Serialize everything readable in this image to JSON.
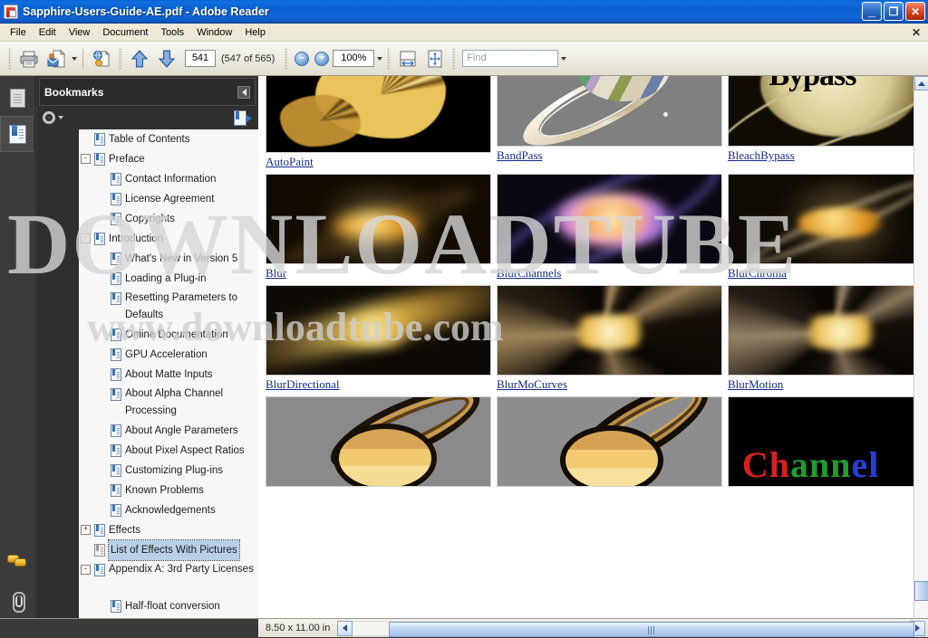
{
  "window": {
    "title": "Sapphire-Users-Guide-AE.pdf - Adobe Reader",
    "app_icon": "pdf-document-icon",
    "minimize_label": "_",
    "restore_label": "❐",
    "close_label": "✕"
  },
  "menubar": {
    "items": [
      {
        "label": "File"
      },
      {
        "label": "Edit"
      },
      {
        "label": "View"
      },
      {
        "label": "Document"
      },
      {
        "label": "Tools"
      },
      {
        "label": "Window"
      },
      {
        "label": "Help"
      }
    ],
    "close_document_label": "✕"
  },
  "toolbar": {
    "print_title": "Print",
    "email_title": "Email",
    "snapshot_title": "Snapshot",
    "previous_page_title": "Previous Page",
    "next_page_title": "Next Page",
    "page_number": "541",
    "page_count_text": "(547 of 565)",
    "zoom_out_label": "–",
    "zoom_in_label": "+",
    "zoom_level": "100%",
    "fit_width_title": "Fit Width",
    "fit_page_title": "Fit Page",
    "find_placeholder": "Find",
    "find_value": ""
  },
  "rail": {
    "items": [
      {
        "name": "pages-panel",
        "icon": "pages-icon",
        "active": false
      },
      {
        "name": "bookmarks-panel",
        "icon": "bookmarks-icon",
        "active": true
      },
      {
        "name": "comments-panel",
        "icon": "comments-icon",
        "active": false
      },
      {
        "name": "attachments-panel",
        "icon": "paperclip-icon",
        "active": false
      }
    ]
  },
  "bookmarks": {
    "panel_title": "Bookmarks",
    "options_label": "Options",
    "collapse_title": "Hide Navigation Pane",
    "expand_current_title": "Expand Current Bookmark",
    "items": [
      {
        "label": "Table of Contents",
        "depth": 1,
        "twisty": "",
        "selected": false,
        "lines": 1,
        "gray": false
      },
      {
        "label": "Preface",
        "depth": 1,
        "twisty": "-",
        "selected": false,
        "lines": 1,
        "gray": false
      },
      {
        "label": "Contact Information",
        "depth": 2,
        "twisty": "",
        "selected": false,
        "lines": 1,
        "gray": false
      },
      {
        "label": "License Agreement",
        "depth": 2,
        "twisty": "",
        "selected": false,
        "lines": 1,
        "gray": false
      },
      {
        "label": "Copyrights",
        "depth": 2,
        "twisty": "",
        "selected": false,
        "lines": 1,
        "gray": false
      },
      {
        "label": "Introduction",
        "depth": 1,
        "twisty": "-",
        "selected": false,
        "lines": 1,
        "gray": false
      },
      {
        "label": "What's New in Version 5",
        "depth": 2,
        "twisty": "",
        "selected": false,
        "lines": 1,
        "gray": false
      },
      {
        "label": "Loading a Plug-in",
        "depth": 2,
        "twisty": "",
        "selected": false,
        "lines": 1,
        "gray": false
      },
      {
        "label": "Resetting Parameters to Defaults",
        "depth": 2,
        "twisty": "",
        "selected": false,
        "lines": 2,
        "gray": false
      },
      {
        "label": "Online Documentation",
        "depth": 2,
        "twisty": "",
        "selected": false,
        "lines": 1,
        "gray": false
      },
      {
        "label": "GPU Acceleration",
        "depth": 2,
        "twisty": "",
        "selected": false,
        "lines": 1,
        "gray": false
      },
      {
        "label": "About Matte Inputs",
        "depth": 2,
        "twisty": "",
        "selected": false,
        "lines": 1,
        "gray": false
      },
      {
        "label": "About Alpha Channel Processing",
        "depth": 2,
        "twisty": "",
        "selected": false,
        "lines": 2,
        "gray": false
      },
      {
        "label": "About Angle Parameters",
        "depth": 2,
        "twisty": "",
        "selected": false,
        "lines": 1,
        "gray": false
      },
      {
        "label": "About Pixel Aspect Ratios",
        "depth": 2,
        "twisty": "",
        "selected": false,
        "lines": 1,
        "gray": false
      },
      {
        "label": "Customizing Plug-ins",
        "depth": 2,
        "twisty": "",
        "selected": false,
        "lines": 1,
        "gray": false
      },
      {
        "label": "Known Problems",
        "depth": 2,
        "twisty": "",
        "selected": false,
        "lines": 1,
        "gray": false
      },
      {
        "label": "Acknowledgements",
        "depth": 2,
        "twisty": "",
        "selected": false,
        "lines": 1,
        "gray": false
      },
      {
        "label": "Effects",
        "depth": 1,
        "twisty": "+",
        "selected": false,
        "lines": 1,
        "gray": false
      },
      {
        "label": "List of Effects With Pictures",
        "depth": 1,
        "twisty": "",
        "selected": true,
        "lines": 1,
        "gray": true
      },
      {
        "label": "Appendix A: 3rd Party Licenses",
        "depth": 1,
        "twisty": "-",
        "selected": false,
        "lines": 2,
        "gray": false
      },
      {
        "label": "Half-float conversion",
        "depth": 2,
        "twisty": "",
        "selected": false,
        "lines": 1,
        "gray": false
      }
    ]
  },
  "document": {
    "watermark_primary": "DOWNLOADTUBE",
    "watermark_secondary": "www.downloadtube.com",
    "effects_grid": [
      [
        {
          "label": "AutoPaint",
          "image": "spiky-yellow-burst-on-black"
        },
        {
          "label": "BandPass",
          "image": "saturn-rainbow-edges-on-gray"
        },
        {
          "label": "BleachBypass",
          "image": "saturn-with-bypass-text"
        }
      ],
      [
        {
          "label": "Blur",
          "image": "blurred-yellow-saturn-on-black"
        },
        {
          "label": "BlurChannels",
          "image": "saturn-rgb-channel-split"
        },
        {
          "label": "BlurChroma",
          "image": "saturn-chroma-blurred"
        }
      ],
      [
        {
          "label": "BlurDirectional",
          "image": "saturn-directional-blur-streaks"
        },
        {
          "label": "BlurMoCurves",
          "image": "saturn-motion-curves-rays"
        },
        {
          "label": "BlurMotion",
          "image": "saturn-motion-blur-rays"
        }
      ],
      [
        {
          "label": "",
          "image": "posterized-saturn-on-gray"
        },
        {
          "label": "",
          "image": "posterized-saturn-variant-on-gray"
        },
        {
          "label": "",
          "image": "channel-colored-text-on-black"
        }
      ]
    ]
  },
  "statusbar": {
    "page_size": "8.50 x 11.00 in",
    "scroll_left_title": "Scroll Left",
    "scroll_right_title": "Scroll Right"
  }
}
